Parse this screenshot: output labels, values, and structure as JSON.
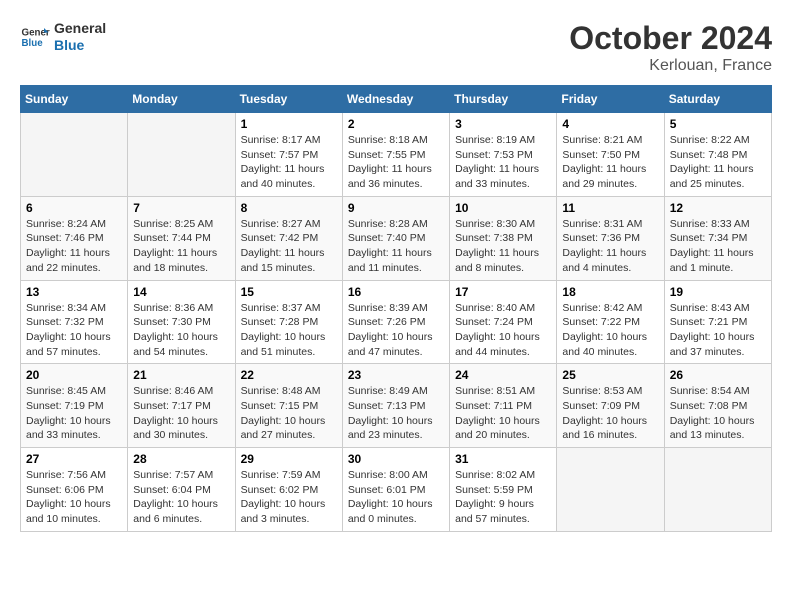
{
  "logo": {
    "line1": "General",
    "line2": "Blue"
  },
  "title": "October 2024",
  "subtitle": "Kerlouan, France",
  "days_header": [
    "Sunday",
    "Monday",
    "Tuesday",
    "Wednesday",
    "Thursday",
    "Friday",
    "Saturday"
  ],
  "weeks": [
    [
      {
        "day": "",
        "detail": ""
      },
      {
        "day": "",
        "detail": ""
      },
      {
        "day": "1",
        "detail": "Sunrise: 8:17 AM\nSunset: 7:57 PM\nDaylight: 11 hours and 40 minutes."
      },
      {
        "day": "2",
        "detail": "Sunrise: 8:18 AM\nSunset: 7:55 PM\nDaylight: 11 hours and 36 minutes."
      },
      {
        "day": "3",
        "detail": "Sunrise: 8:19 AM\nSunset: 7:53 PM\nDaylight: 11 hours and 33 minutes."
      },
      {
        "day": "4",
        "detail": "Sunrise: 8:21 AM\nSunset: 7:50 PM\nDaylight: 11 hours and 29 minutes."
      },
      {
        "day": "5",
        "detail": "Sunrise: 8:22 AM\nSunset: 7:48 PM\nDaylight: 11 hours and 25 minutes."
      }
    ],
    [
      {
        "day": "6",
        "detail": "Sunrise: 8:24 AM\nSunset: 7:46 PM\nDaylight: 11 hours and 22 minutes."
      },
      {
        "day": "7",
        "detail": "Sunrise: 8:25 AM\nSunset: 7:44 PM\nDaylight: 11 hours and 18 minutes."
      },
      {
        "day": "8",
        "detail": "Sunrise: 8:27 AM\nSunset: 7:42 PM\nDaylight: 11 hours and 15 minutes."
      },
      {
        "day": "9",
        "detail": "Sunrise: 8:28 AM\nSunset: 7:40 PM\nDaylight: 11 hours and 11 minutes."
      },
      {
        "day": "10",
        "detail": "Sunrise: 8:30 AM\nSunset: 7:38 PM\nDaylight: 11 hours and 8 minutes."
      },
      {
        "day": "11",
        "detail": "Sunrise: 8:31 AM\nSunset: 7:36 PM\nDaylight: 11 hours and 4 minutes."
      },
      {
        "day": "12",
        "detail": "Sunrise: 8:33 AM\nSunset: 7:34 PM\nDaylight: 11 hours and 1 minute."
      }
    ],
    [
      {
        "day": "13",
        "detail": "Sunrise: 8:34 AM\nSunset: 7:32 PM\nDaylight: 10 hours and 57 minutes."
      },
      {
        "day": "14",
        "detail": "Sunrise: 8:36 AM\nSunset: 7:30 PM\nDaylight: 10 hours and 54 minutes."
      },
      {
        "day": "15",
        "detail": "Sunrise: 8:37 AM\nSunset: 7:28 PM\nDaylight: 10 hours and 51 minutes."
      },
      {
        "day": "16",
        "detail": "Sunrise: 8:39 AM\nSunset: 7:26 PM\nDaylight: 10 hours and 47 minutes."
      },
      {
        "day": "17",
        "detail": "Sunrise: 8:40 AM\nSunset: 7:24 PM\nDaylight: 10 hours and 44 minutes."
      },
      {
        "day": "18",
        "detail": "Sunrise: 8:42 AM\nSunset: 7:22 PM\nDaylight: 10 hours and 40 minutes."
      },
      {
        "day": "19",
        "detail": "Sunrise: 8:43 AM\nSunset: 7:21 PM\nDaylight: 10 hours and 37 minutes."
      }
    ],
    [
      {
        "day": "20",
        "detail": "Sunrise: 8:45 AM\nSunset: 7:19 PM\nDaylight: 10 hours and 33 minutes."
      },
      {
        "day": "21",
        "detail": "Sunrise: 8:46 AM\nSunset: 7:17 PM\nDaylight: 10 hours and 30 minutes."
      },
      {
        "day": "22",
        "detail": "Sunrise: 8:48 AM\nSunset: 7:15 PM\nDaylight: 10 hours and 27 minutes."
      },
      {
        "day": "23",
        "detail": "Sunrise: 8:49 AM\nSunset: 7:13 PM\nDaylight: 10 hours and 23 minutes."
      },
      {
        "day": "24",
        "detail": "Sunrise: 8:51 AM\nSunset: 7:11 PM\nDaylight: 10 hours and 20 minutes."
      },
      {
        "day": "25",
        "detail": "Sunrise: 8:53 AM\nSunset: 7:09 PM\nDaylight: 10 hours and 16 minutes."
      },
      {
        "day": "26",
        "detail": "Sunrise: 8:54 AM\nSunset: 7:08 PM\nDaylight: 10 hours and 13 minutes."
      }
    ],
    [
      {
        "day": "27",
        "detail": "Sunrise: 7:56 AM\nSunset: 6:06 PM\nDaylight: 10 hours and 10 minutes."
      },
      {
        "day": "28",
        "detail": "Sunrise: 7:57 AM\nSunset: 6:04 PM\nDaylight: 10 hours and 6 minutes."
      },
      {
        "day": "29",
        "detail": "Sunrise: 7:59 AM\nSunset: 6:02 PM\nDaylight: 10 hours and 3 minutes."
      },
      {
        "day": "30",
        "detail": "Sunrise: 8:00 AM\nSunset: 6:01 PM\nDaylight: 10 hours and 0 minutes."
      },
      {
        "day": "31",
        "detail": "Sunrise: 8:02 AM\nSunset: 5:59 PM\nDaylight: 9 hours and 57 minutes."
      },
      {
        "day": "",
        "detail": ""
      },
      {
        "day": "",
        "detail": ""
      }
    ]
  ]
}
